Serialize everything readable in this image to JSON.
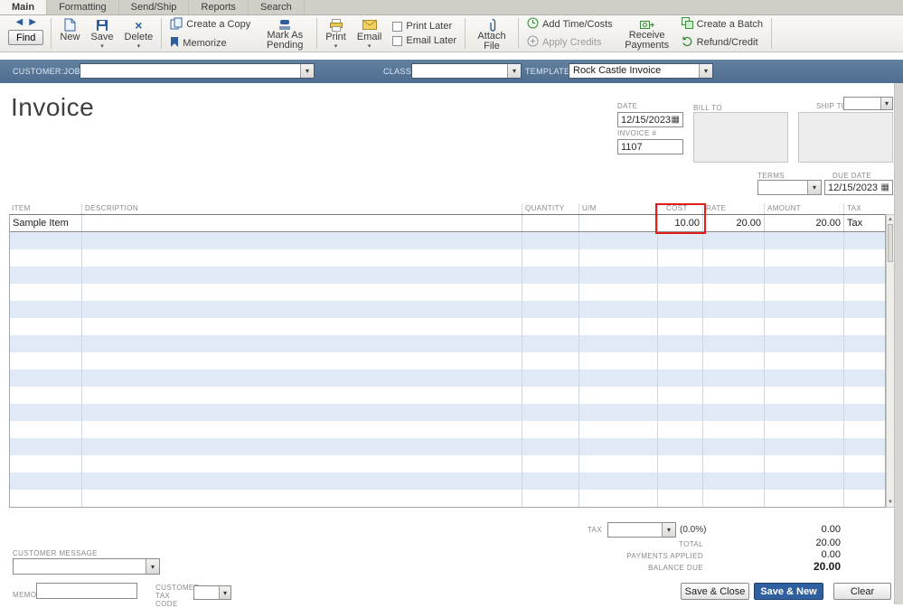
{
  "colors": {
    "header_bar_blue": "#56749c",
    "row_alt_blue": "#dfeaf6",
    "primary_button_blue": "#30609f",
    "highlight_box_red": "#e21b1b"
  },
  "tabs": {
    "items": [
      {
        "label": "Main",
        "active": true
      },
      {
        "label": "Formatting",
        "active": false
      },
      {
        "label": "Send/Ship",
        "active": false
      },
      {
        "label": "Reports",
        "active": false
      },
      {
        "label": "Search",
        "active": false
      }
    ]
  },
  "toolbar": {
    "find_label": "Find",
    "new_label": "New",
    "save_label": "Save",
    "delete_label": "Delete",
    "create_copy_label": "Create a Copy",
    "memorize_label": "Memorize",
    "mark_pending_label": "Mark As Pending",
    "print_label": "Print",
    "email_label": "Email",
    "print_later_label": "Print Later",
    "email_later_label": "Email Later",
    "attach_file_label": "Attach File",
    "add_time_costs_label": "Add Time/Costs",
    "apply_credits_label": "Apply Credits",
    "receive_payments_label": "Receive Payments",
    "create_batch_label": "Create a Batch",
    "refund_credit_label": "Refund/Credit"
  },
  "header_bar": {
    "customer_job_label": "CUSTOMER:JOB",
    "customer_job_value": "",
    "class_label": "CLASS",
    "class_value": "",
    "template_label": "TEMPLATE",
    "template_value": "Rock Castle Invoice"
  },
  "invoice": {
    "title": "Invoice",
    "date_label": "DATE",
    "date_value": "12/15/2023",
    "number_label": "INVOICE #",
    "number_value": "1107",
    "bill_to_label": "BILL TO",
    "ship_to_label": "SHIP TO",
    "ship_to_value": "",
    "terms_label": "TERMS",
    "terms_value": "",
    "due_date_label": "DUE DATE",
    "due_date_value": "12/15/2023"
  },
  "table": {
    "columns": [
      "ITEM",
      "DESCRIPTION",
      "QUANTITY",
      "U/M",
      "COST",
      "RATE",
      "AMOUNT",
      "TAX"
    ],
    "rows": [
      {
        "item": "Sample Item",
        "description": "",
        "quantity": "",
        "um": "",
        "cost": "10.00",
        "rate": "20.00",
        "amount": "20.00",
        "tax": "Tax"
      }
    ],
    "empty_row_count": 16
  },
  "totals": {
    "tax_label": "TAX",
    "tax_select_value": "",
    "tax_rate": "(0.0%)",
    "tax_amount": "0.00",
    "total_label": "TOTAL",
    "total_amount": "20.00",
    "payments_label": "PAYMENTS APPLIED",
    "payments_amount": "0.00",
    "balance_label": "BALANCE DUE",
    "balance_amount": "20.00"
  },
  "footer": {
    "customer_message_label": "CUSTOMER MESSAGE",
    "customer_message_value": "",
    "memo_label": "MEMO",
    "memo_value": "",
    "customer_tax_code_label": "CUSTOMER TAX CODE",
    "customer_tax_code_value": "",
    "save_close_label": "Save & Close",
    "save_new_label": "Save & New",
    "clear_label": "Clear"
  }
}
